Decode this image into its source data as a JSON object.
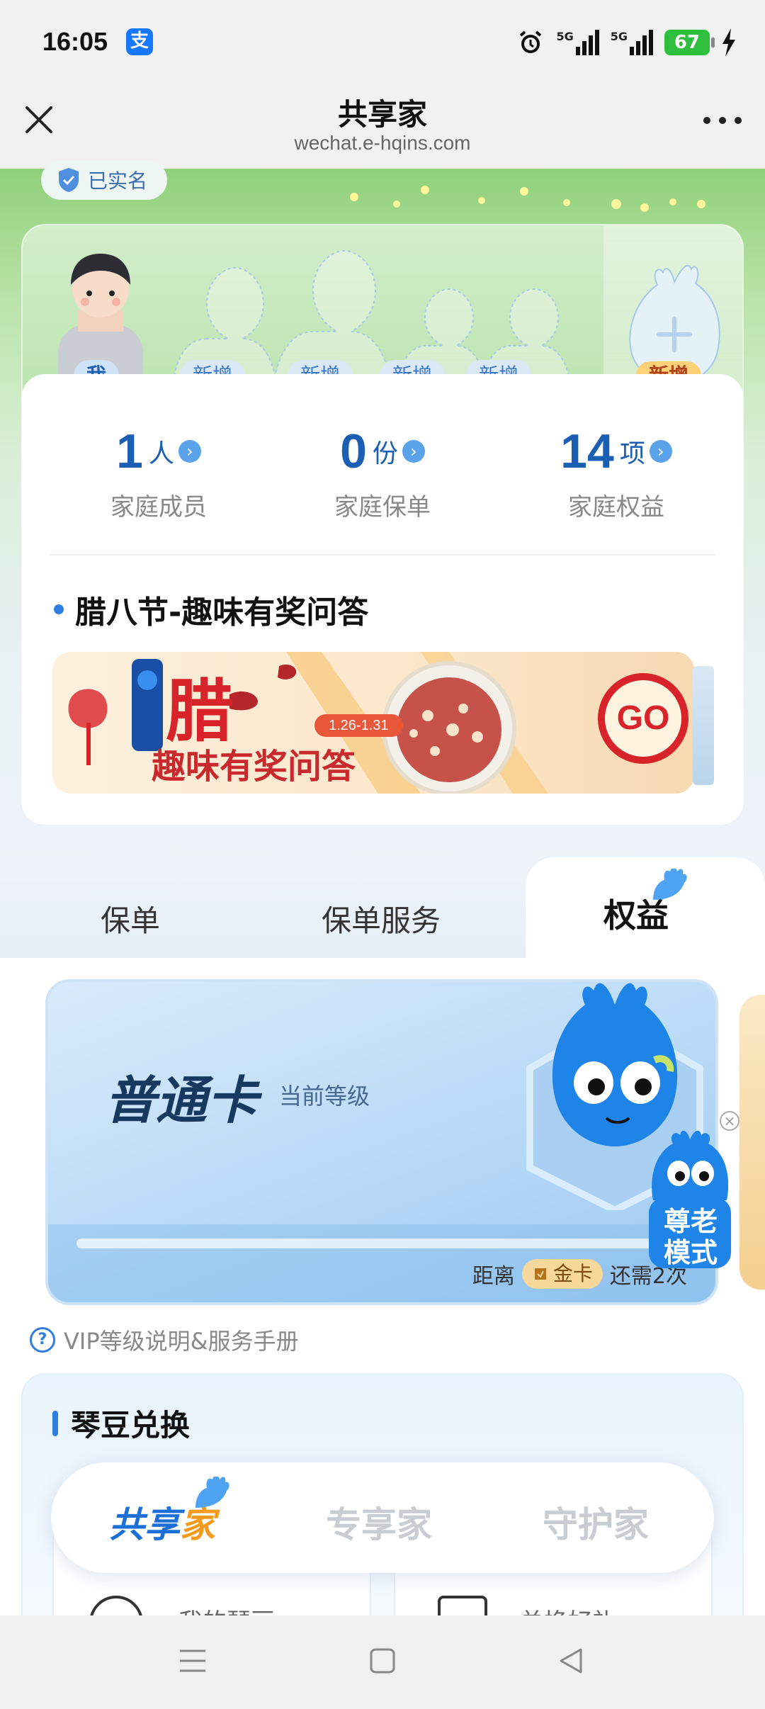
{
  "status_bar": {
    "time": "16:05",
    "app_badge": "支",
    "alarm_icon": "alarm-icon",
    "network_1": "5G",
    "network_2": "5G",
    "battery": "67"
  },
  "nav": {
    "title": "共享家",
    "url": "wechat.e-hqins.com",
    "close_icon": "close-icon",
    "more_icon": "more-icon"
  },
  "verified_label": "已实名",
  "family": {
    "members": [
      {
        "label": "我"
      },
      {
        "label": "新增"
      },
      {
        "label": "新增"
      },
      {
        "label": "新增"
      },
      {
        "label": "新增"
      }
    ],
    "add_label": "新增",
    "stats": [
      {
        "number": "1",
        "unit": "人",
        "label": "家庭成员"
      },
      {
        "number": "0",
        "unit": "份",
        "label": "家庭保单"
      },
      {
        "number": "14",
        "unit": "项",
        "label": "家庭权益"
      }
    ],
    "promo_title": "腊八节-趣味有奖问答",
    "banner": {
      "big_char": "腊",
      "date": "1.26-1.31",
      "text": "趣味有奖问答",
      "go": "GO"
    }
  },
  "tabs": {
    "items": [
      "保单",
      "保单服务",
      "权益"
    ],
    "active": "权益"
  },
  "vip": {
    "level": "普通卡",
    "current_label": "当前等级",
    "hint_prefix": "距离",
    "gold_label": "金卡",
    "hint_suffix": "还需2次",
    "link": "VIP等级说明&服务手册"
  },
  "elder_mode": {
    "line1": "尊老",
    "line2": "模式"
  },
  "exchange": {
    "title": "琴豆兑换",
    "items": [
      {
        "label": "我的琴豆 ›"
      },
      {
        "label": "兑换好礼 ›"
      }
    ]
  },
  "bottom_tabs": {
    "items": [
      {
        "main": "共享",
        "highlight": "家"
      },
      {
        "main": "专享家",
        "highlight": ""
      },
      {
        "main": "守护家",
        "highlight": ""
      }
    ]
  },
  "colors": {
    "primary": "#1b6fd6",
    "accent_orange": "#f59a1b",
    "hero_green": "#8fd07a"
  }
}
